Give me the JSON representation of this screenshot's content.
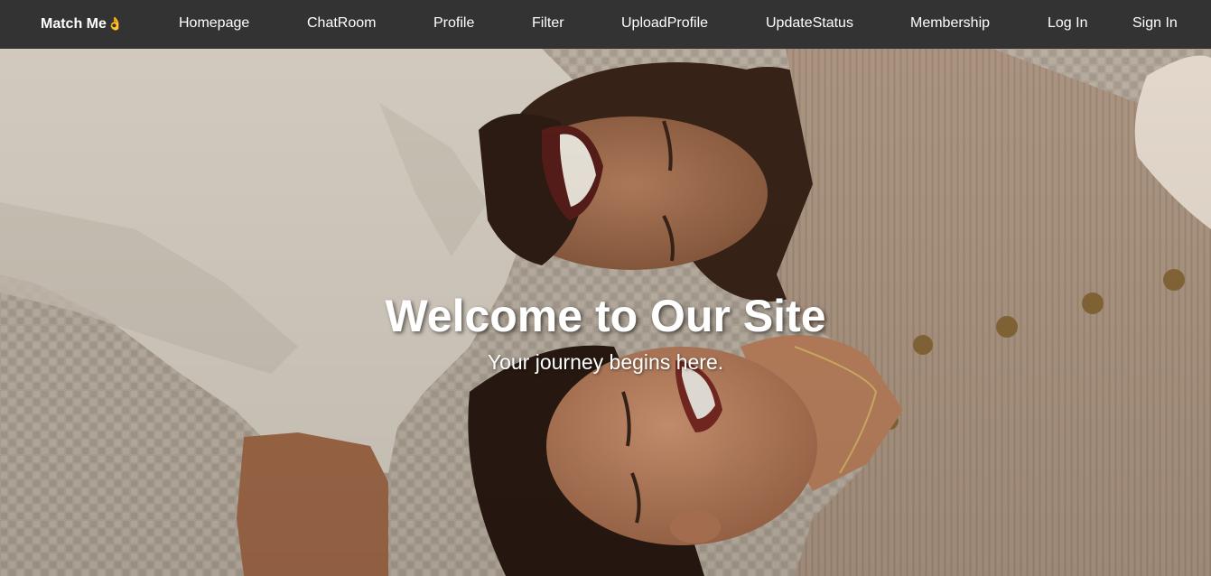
{
  "navbar": {
    "brand": "Match Me",
    "brand_icon": "ok-hand-icon",
    "links": {
      "homepage": "Homepage",
      "chatroom": "ChatRoom",
      "profile": "Profile",
      "filter": "Filter",
      "upload_profile": "UploadProfile",
      "update_status": "UpdateStatus",
      "membership": "Membership",
      "login": "Log In",
      "signin": "Sign In"
    },
    "background": "#333333"
  },
  "hero": {
    "title": "Welcome to Our Site",
    "subtitle": "Your journey begins here.",
    "image": "smiling-couple-lying-on-blanket-photo"
  }
}
